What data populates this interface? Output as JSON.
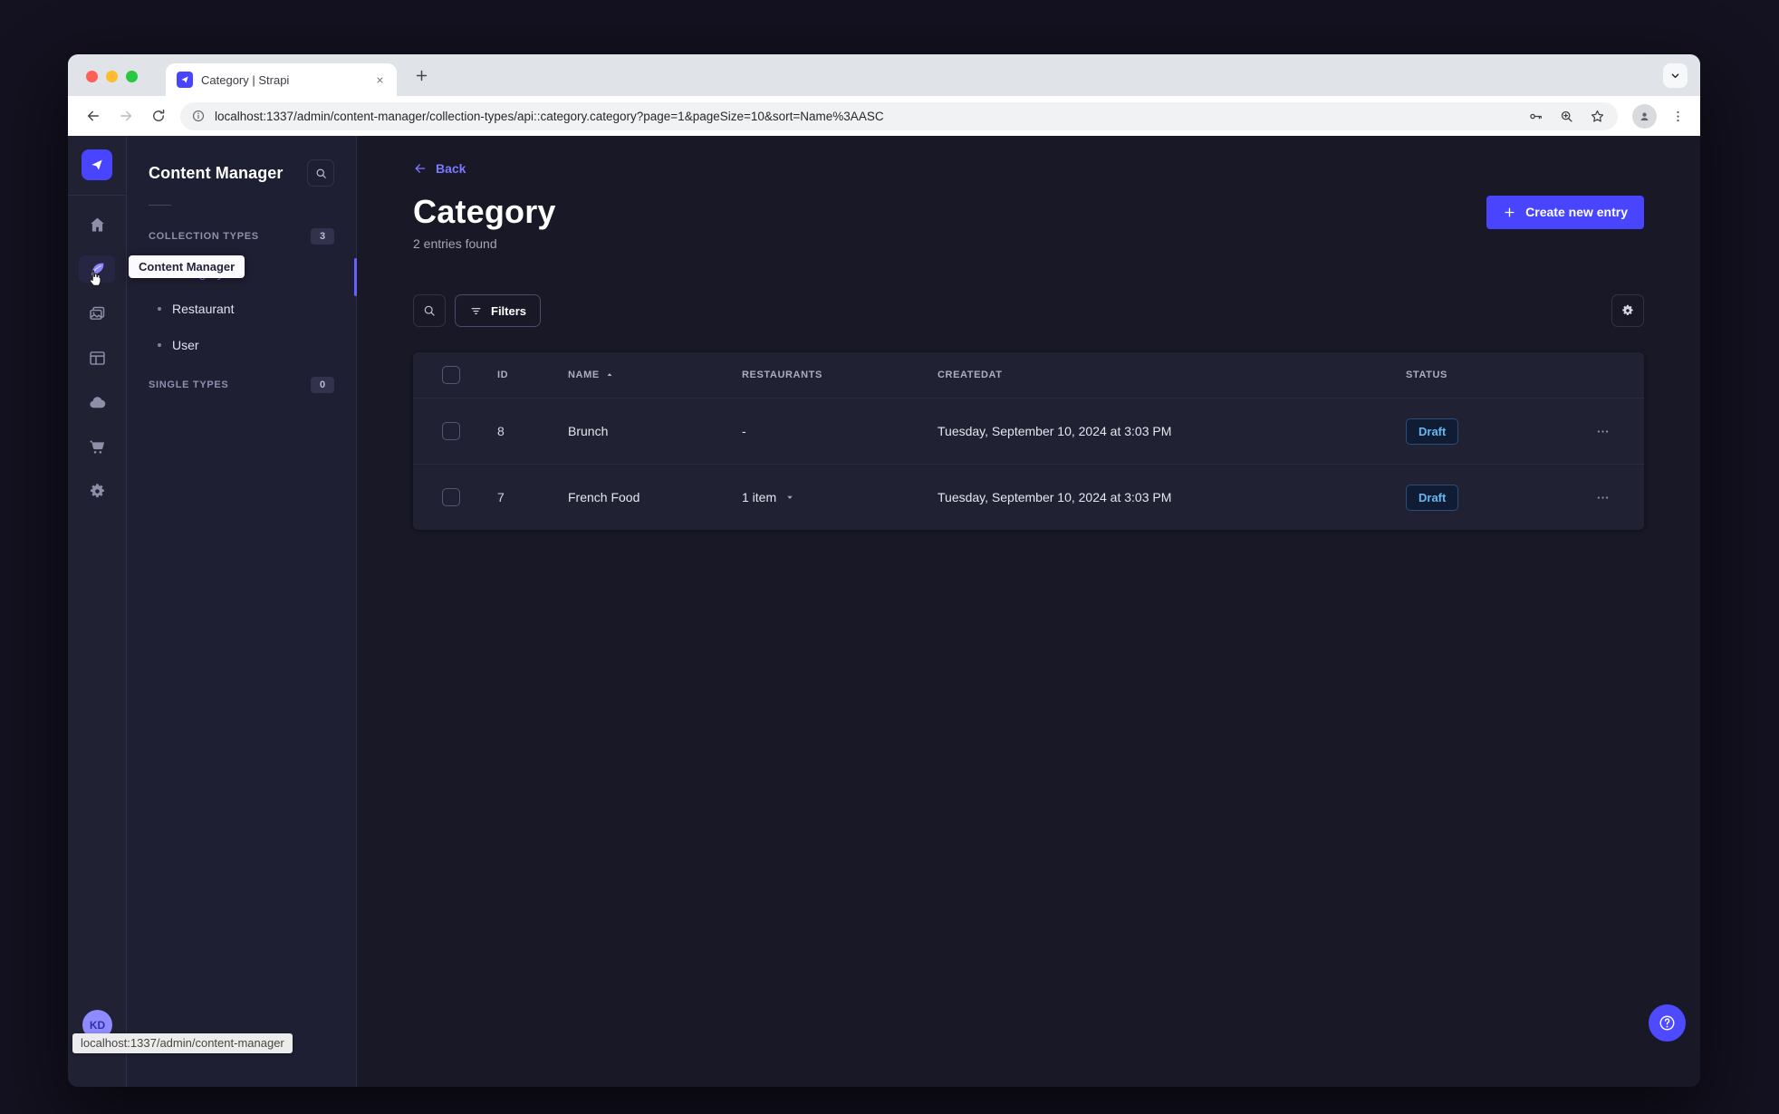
{
  "browser": {
    "tab_title": "Category | Strapi",
    "url": "localhost:1337/admin/content-manager/collection-types/api::category.category?page=1&pageSize=10&sort=Name%3AASC",
    "status_tooltip": "localhost:1337/admin/content-manager"
  },
  "nav_rail": {
    "items": [
      {
        "name": "home",
        "icon": "home-icon",
        "active": false
      },
      {
        "name": "content-manager",
        "icon": "pen-icon",
        "active": true
      },
      {
        "name": "media-library",
        "icon": "images-icon",
        "active": false
      },
      {
        "name": "content-type-builder",
        "icon": "layout-icon",
        "active": false
      },
      {
        "name": "cloud",
        "icon": "cloud-icon",
        "active": false
      },
      {
        "name": "marketplace",
        "icon": "cart-icon",
        "active": false
      },
      {
        "name": "settings",
        "icon": "gear-icon",
        "active": false
      }
    ],
    "avatar_initials": "KD",
    "tooltip": "Content Manager"
  },
  "subnav": {
    "title": "Content Manager",
    "sections": [
      {
        "label": "COLLECTION TYPES",
        "badge": "3",
        "items": [
          {
            "label": "Category",
            "active": true
          },
          {
            "label": "Restaurant",
            "active": false
          },
          {
            "label": "User",
            "active": false
          }
        ]
      },
      {
        "label": "SINGLE TYPES",
        "badge": "0",
        "items": []
      }
    ]
  },
  "main": {
    "back_label": "Back",
    "title": "Category",
    "subtitle": "2 entries found",
    "create_button_label": "Create new entry",
    "filters_label": "Filters",
    "table": {
      "columns": [
        "ID",
        "NAME",
        "RESTAURANTS",
        "CREATEDAT",
        "STATUS"
      ],
      "sorted_by": "NAME",
      "sort_direction": "asc",
      "rows": [
        {
          "id": "8",
          "name": "Brunch",
          "restaurants": "-",
          "has_caret": false,
          "created_at": "Tuesday, September 10, 2024 at 3:03 PM",
          "status": "Draft"
        },
        {
          "id": "7",
          "name": "French Food",
          "restaurants": "1 item",
          "has_caret": true,
          "created_at": "Tuesday, September 10, 2024 at 3:03 PM",
          "status": "Draft"
        }
      ]
    }
  },
  "colors": {
    "primary": "#4945ff",
    "link": "#7b79ff",
    "surface": "#212134",
    "background": "#181826",
    "border": "#32324d",
    "draft_text": "#66b7f1"
  }
}
